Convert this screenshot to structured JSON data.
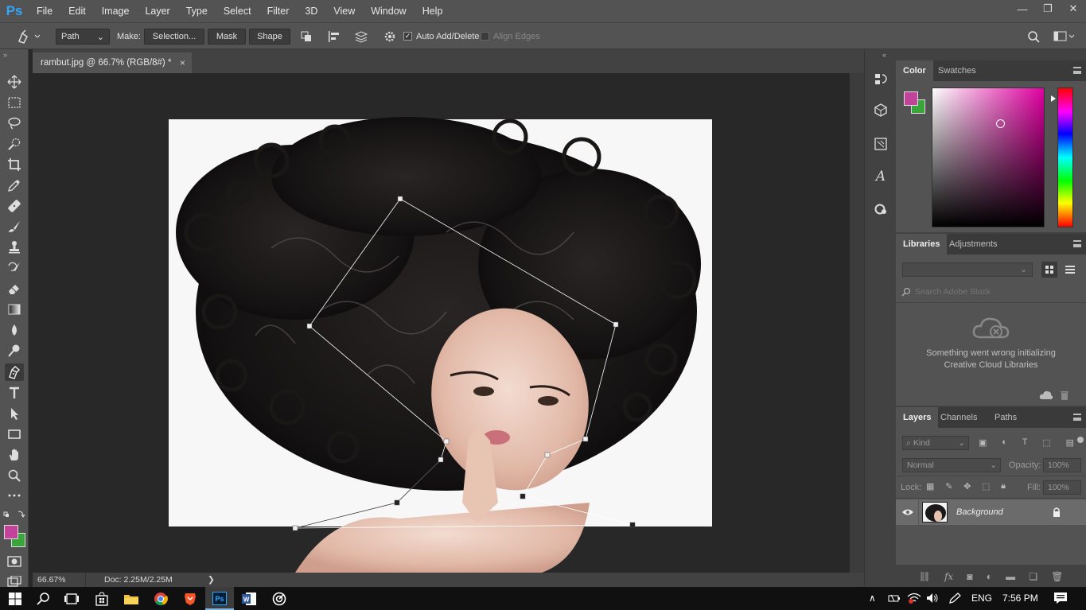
{
  "app": {
    "logo": "Ps"
  },
  "menu": [
    "File",
    "Edit",
    "Image",
    "Layer",
    "Type",
    "Select",
    "Filter",
    "3D",
    "View",
    "Window",
    "Help"
  ],
  "window_controls": {
    "minimize": "—",
    "restore": "❐",
    "close": "✕"
  },
  "options_bar": {
    "mode": "Path",
    "make_label": "Make:",
    "selection_button": "Selection...",
    "mask_button": "Mask",
    "shape_button": "Shape",
    "auto_add_delete": "Auto Add/Delete",
    "auto_add_delete_checked": true,
    "align_edges": "Align Edges",
    "align_edges_checked": false
  },
  "document": {
    "tab_title": "rambut.jpg @ 66.7% (RGB/8#) *",
    "tab_close": "×",
    "zoom": "66.67%",
    "doc_info": "Doc: 2.25M/2.25M",
    "status_arrow": "❯"
  },
  "colors": {
    "foreground": "#c2449a",
    "background": "#3aa53a",
    "accent": "#31a8ff"
  },
  "color_panel": {
    "tabs": [
      "Color",
      "Swatches"
    ],
    "active_tab": "Color"
  },
  "libraries_panel": {
    "tabs": [
      "Libraries",
      "Adjustments"
    ],
    "active_tab": "Libraries",
    "search_placeholder": "Search Adobe Stock",
    "error_line1": "Something went wrong initializing",
    "error_line2": "Creative Cloud Libraries"
  },
  "layers_panel": {
    "tabs": [
      "Layers",
      "Channels",
      "Paths"
    ],
    "active_tab": "Layers",
    "filter_kind": "Kind",
    "blend_mode": "Normal",
    "opacity_label": "Opacity:",
    "opacity_value": "100%",
    "lock_label": "Lock:",
    "fill_label": "Fill:",
    "fill_value": "100%",
    "layers": [
      {
        "name": "Background",
        "visible": true,
        "locked": true
      }
    ]
  },
  "taskbar": {
    "language": "ENG",
    "time": "7:56 PM"
  }
}
